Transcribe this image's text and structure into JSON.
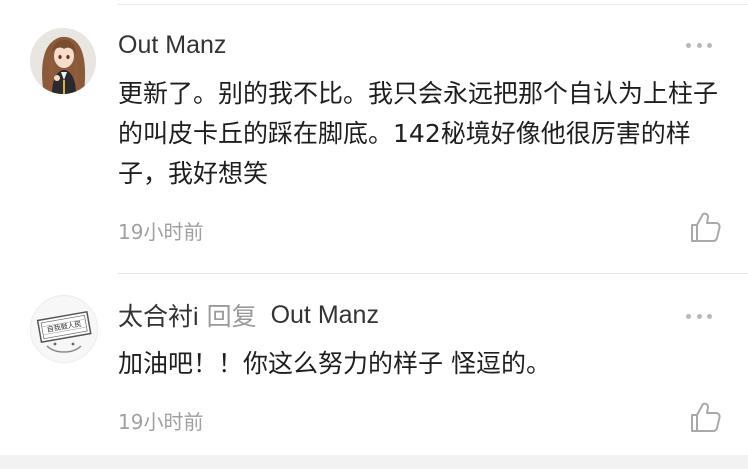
{
  "comments": [
    {
      "username": "Out Manz",
      "text": "更新了。别的我不比。我只会永远把那个自认为上柱子的叫皮卡丘的踩在脚底。142秘境好像他很厉害的样子，我好想笑",
      "time": "19小时前"
    },
    {
      "username": "太合衬i",
      "reply_word": "回复",
      "reply_target": "Out Manz",
      "text": "加油吧！！你这么努力的样子 怪逗的。",
      "time": "19小时前",
      "avatar_stamp_text": "自我鼓人民"
    }
  ],
  "colors": {
    "username": "#333333",
    "reply_word": "#9a9a9a",
    "timestamp": "#a0a0a0",
    "text": "#1e1e1e",
    "divider": "#e6e6e6"
  },
  "icons": [
    "more-icon",
    "thumbs-up-icon"
  ]
}
